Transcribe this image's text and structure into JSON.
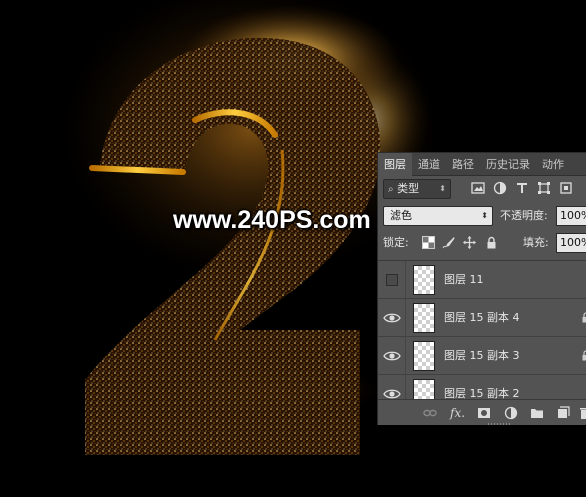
{
  "watermark": "www.240PS.com",
  "layers_panel": {
    "tabs": [
      {
        "label": "图层",
        "active": true
      },
      {
        "label": "通道",
        "active": false
      },
      {
        "label": "路径",
        "active": false
      },
      {
        "label": "历史记录",
        "active": false
      },
      {
        "label": "动作",
        "active": false
      }
    ],
    "filter_kind": "类型",
    "filter_icons": [
      "image-filter-icon",
      "adjustment-filter-icon",
      "type-filter-icon",
      "shape-filter-icon",
      "smart-object-filter-icon"
    ],
    "blend_mode": "滤色",
    "opacity_label": "不透明度:",
    "opacity_value": "100%",
    "lock_label": "锁定:",
    "lock_icons": [
      "lock-transparent-icon",
      "lock-image-icon",
      "lock-position-icon",
      "lock-all-icon"
    ],
    "fill_label": "填充:",
    "fill_value": "100%",
    "layers": [
      {
        "name": "图层 11",
        "visible": false,
        "locked": false
      },
      {
        "name": "图层 15 副本 4",
        "visible": true,
        "locked": true
      },
      {
        "name": "图层 15 副本 3",
        "visible": true,
        "locked": true
      },
      {
        "name": "图层 15 副本 2",
        "visible": true,
        "locked": true
      }
    ],
    "bottom_icons": [
      "link-layers-icon",
      "fx-icon",
      "add-mask-icon",
      "adjustment-layer-icon",
      "new-group-icon",
      "new-layer-icon",
      "delete-layer-icon"
    ],
    "fx_text": "fx."
  },
  "colors": {
    "panel_bg": "#535353",
    "glow": "#f5b84a",
    "gold_edge": "#e0a010"
  }
}
